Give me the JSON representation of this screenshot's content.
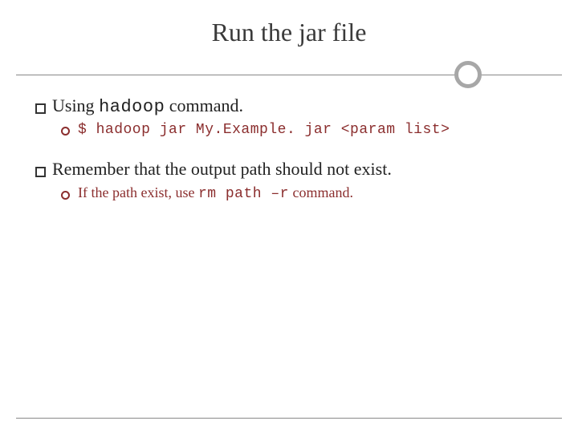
{
  "title": "Run the jar file",
  "bullets": [
    {
      "prefix": "Using ",
      "code": "hadoop",
      "suffix": " command.",
      "sub": {
        "text": "$ hadoop jar My.Example. jar <param list>"
      }
    },
    {
      "prefix": "Remember that the output path should not exist.",
      "code": "",
      "suffix": "",
      "sub": {
        "pre": "If the path exist, use ",
        "code": "rm path –r",
        "post": " command."
      }
    }
  ]
}
